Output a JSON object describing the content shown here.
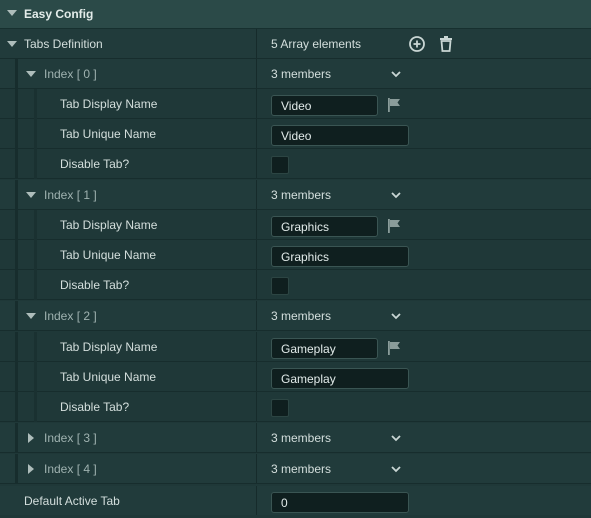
{
  "section": {
    "title": "Easy Config"
  },
  "tabs_definition": {
    "label": "Tabs Definition",
    "summary": "5 Array elements",
    "add_icon": "plus-circle-icon",
    "delete_icon": "trash-icon"
  },
  "elements": [
    {
      "label": "Index [ 0 ]",
      "members": "3 members",
      "expanded": true,
      "display_label": "Tab Display Name",
      "display_value": "Video",
      "unique_label": "Tab Unique Name",
      "unique_value": "Video",
      "disable_label": "Disable Tab?"
    },
    {
      "label": "Index [ 1 ]",
      "members": "3 members",
      "expanded": true,
      "display_label": "Tab Display Name",
      "display_value": "Graphics",
      "unique_label": "Tab Unique Name",
      "unique_value": "Graphics",
      "disable_label": "Disable Tab?"
    },
    {
      "label": "Index [ 2 ]",
      "members": "3 members",
      "expanded": true,
      "display_label": "Tab Display Name",
      "display_value": "Gameplay",
      "unique_label": "Tab Unique Name",
      "unique_value": "Gameplay",
      "disable_label": "Disable Tab?"
    },
    {
      "label": "Index [ 3 ]",
      "members": "3 members",
      "expanded": false
    },
    {
      "label": "Index [ 4 ]",
      "members": "3 members",
      "expanded": false
    }
  ],
  "default_active_tab": {
    "label": "Default Active Tab",
    "value": "0"
  },
  "colors": {
    "background": "#1f3838",
    "header": "#2b4a48",
    "input": "#0f1f1f",
    "text": "#d4dfdd"
  }
}
